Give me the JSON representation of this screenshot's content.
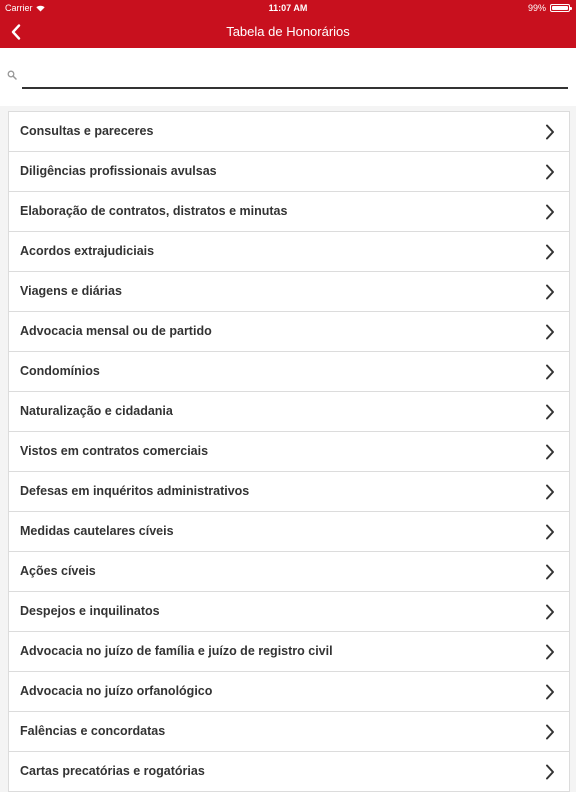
{
  "status_bar": {
    "carrier": "Carrier",
    "time": "11:07 AM",
    "battery": "99%",
    "battery_level": 0.99
  },
  "nav": {
    "title": "Tabela de Honorários",
    "back_icon": "chevron-left-icon"
  },
  "search": {
    "value": "",
    "placeholder": "",
    "icon": "search-icon"
  },
  "items": [
    {
      "label": "Consultas e pareceres"
    },
    {
      "label": "Diligências profissionais avulsas"
    },
    {
      "label": "Elaboração de contratos, distratos e minutas"
    },
    {
      "label": "Acordos extrajudiciais"
    },
    {
      "label": "Viagens e diárias"
    },
    {
      "label": "Advocacia mensal ou de partido"
    },
    {
      "label": "Condomínios"
    },
    {
      "label": "Naturalização e cidadania"
    },
    {
      "label": "Vistos em contratos comerciais"
    },
    {
      "label": "Defesas em inquéritos administrativos"
    },
    {
      "label": "Medidas cautelares cíveis"
    },
    {
      "label": "Ações cíveis"
    },
    {
      "label": "Despejos e inquilinatos"
    },
    {
      "label": "Advocacia no juízo de família e juízo de registro civil"
    },
    {
      "label": "Advocacia no juízo orfanológico"
    },
    {
      "label": "Falências e concordatas"
    },
    {
      "label": "Cartas precatórias e rogatórias"
    }
  ],
  "colors": {
    "brand": "#c8101e",
    "text": "#333333",
    "divider": "#dcdcdc"
  }
}
